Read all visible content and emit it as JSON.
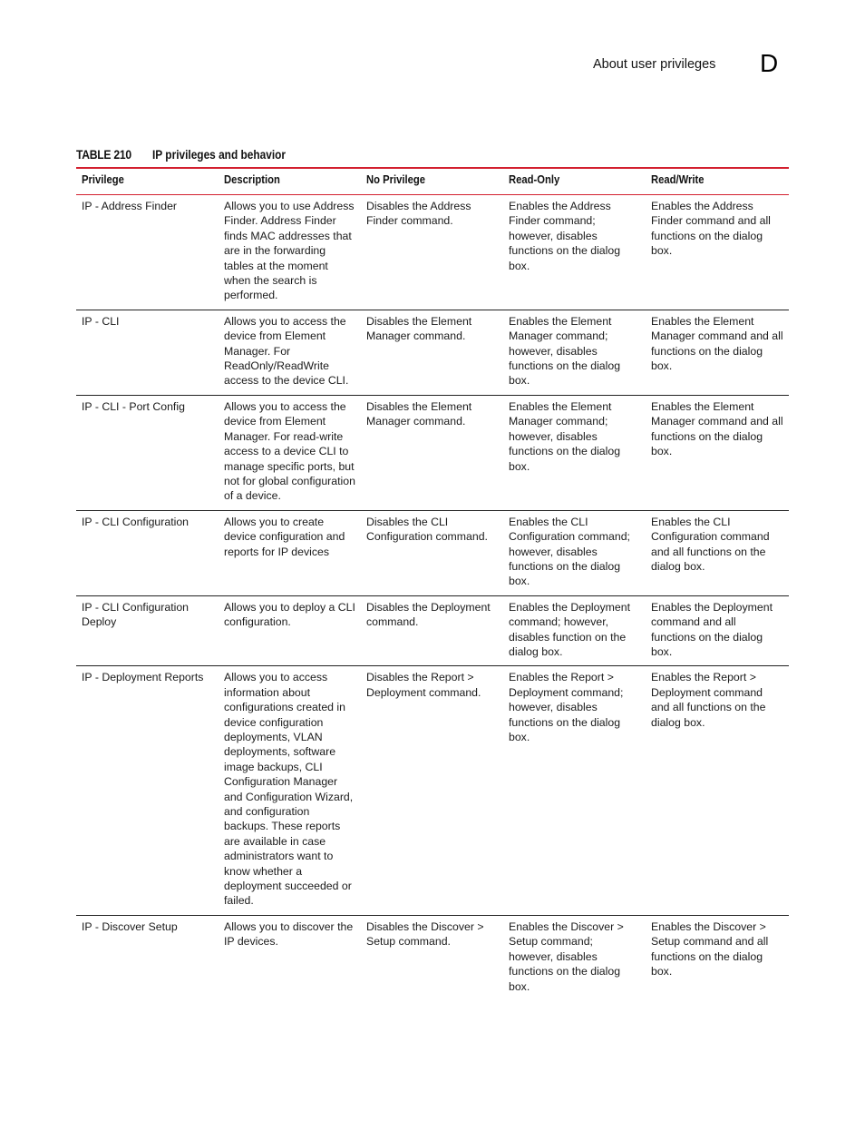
{
  "header": {
    "running_head": "About user privileges",
    "chapter_letter": "D"
  },
  "table": {
    "label": "TABLE 210",
    "title": "IP privileges and behavior",
    "columns": [
      "Privilege",
      "Description",
      "No Privilege",
      "Read-Only",
      "Read/Write"
    ],
    "rows": [
      {
        "privilege": "IP - Address Finder",
        "description": "Allows you to use Address Finder. Address Finder finds MAC addresses that are in the forwarding tables at the moment when the search is performed.",
        "no_privilege": "Disables the Address Finder command.",
        "read_only": "Enables the Address Finder command; however, disables functions on the dialog box.",
        "read_write": "Enables the Address Finder command and all functions on the dialog box."
      },
      {
        "privilege": "IP - CLI",
        "description": "Allows you to access the device from Element Manager. For ReadOnly/ReadWrite access to the device CLI.",
        "no_privilege": "Disables the Element Manager command.",
        "read_only": "Enables the Element Manager command; however, disables functions on the dialog box.",
        "read_write": "Enables the Element Manager command and all functions on the dialog box."
      },
      {
        "privilege": "IP - CLI - Port Config",
        "description": "Allows you to access the device from Element Manager. For read-write access to a device CLI to manage specific ports, but not for global configuration of a device.",
        "no_privilege": "Disables the Element Manager command.",
        "read_only": "Enables the Element Manager command; however, disables functions on the dialog box.",
        "read_write": "Enables the Element Manager command and all functions on the dialog box."
      },
      {
        "privilege": "IP - CLI Configuration",
        "description": "Allows you to create device configuration and reports for IP devices",
        "no_privilege": "Disables the CLI Configuration command.",
        "read_only": "Enables the CLI Configuration command; however, disables functions on the dialog box.",
        "read_write": "Enables the CLI Configuration command and all functions on the dialog box."
      },
      {
        "privilege": "IP - CLI Configuration Deploy",
        "description": "Allows you to deploy a CLI configuration.",
        "no_privilege": "Disables the Deployment command.",
        "read_only": "Enables the Deployment command; however, disables function on the dialog box.",
        "read_write": "Enables the Deployment command and all functions on the dialog box."
      },
      {
        "privilege": "IP - Deployment Reports",
        "description": "Allows you to access information about configurations created in device configuration deployments, VLAN deployments, software image backups, CLI Configuration Manager and Configuration Wizard, and configuration backups. These reports are available in case administrators want to know whether a deployment succeeded or failed.",
        "no_privilege": "Disables the Report > Deployment command.",
        "read_only": "Enables the Report > Deployment command; however, disables functions on the dialog box.",
        "read_write": "Enables the Report > Deployment command and all functions on the dialog box."
      },
      {
        "privilege": "IP - Discover Setup",
        "description": "Allows you to discover the IP devices.",
        "no_privilege": "Disables the Discover > Setup command.",
        "read_only": "Enables the Discover > Setup command; however, disables functions on the dialog box.",
        "read_write": "Enables the Discover > Setup command and all functions on the dialog box."
      }
    ]
  },
  "colors": {
    "accent_red": "#d3202f",
    "rule": "#222222"
  }
}
